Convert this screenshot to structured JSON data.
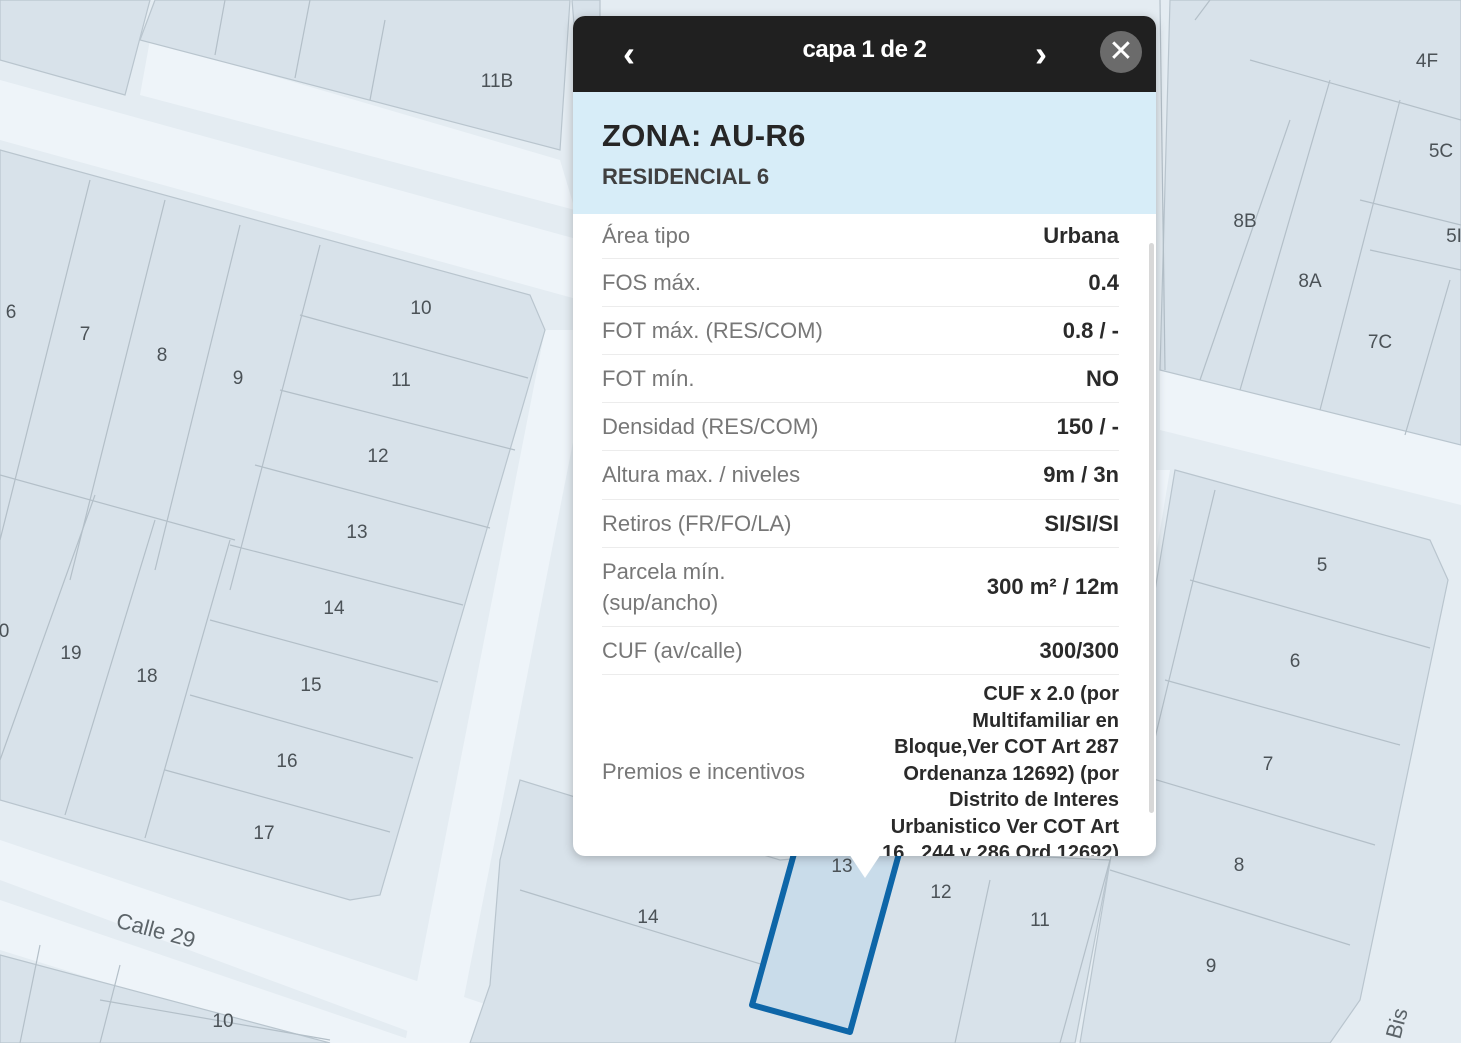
{
  "map": {
    "street_name": "Calle 29",
    "street_name_small": "Bis",
    "highlight_color": "#0e66a8",
    "lot_labels": [
      "11B",
      "6",
      "7",
      "8",
      "9",
      "10",
      "11",
      "12",
      "13",
      "14",
      "15",
      "16",
      "17",
      "18",
      "19",
      "0",
      "4F",
      "5C",
      "8B",
      "5I",
      "8A",
      "7C",
      "5",
      "6",
      "7",
      "8",
      "9",
      "10",
      "11",
      "12",
      "14",
      "13"
    ]
  },
  "popup": {
    "header": {
      "title": "capa 1 de 2",
      "prev_label": "‹",
      "next_label": "›",
      "close_label": "✕"
    },
    "zone_title": "ZONA: AU-R6",
    "zone_subtitle": "RESIDENCIAL 6",
    "attributes": [
      {
        "key": "Área tipo",
        "value": "Urbana"
      },
      {
        "key": "FOS máx.",
        "value": "0.4"
      },
      {
        "key": "FOT máx. (RES/COM)",
        "value": "0.8 / -"
      },
      {
        "key": "FOT mín.",
        "value": "NO"
      },
      {
        "key": "Densidad (RES/COM)",
        "value": "150 / -"
      },
      {
        "key": "Altura max. / niveles",
        "value": "9m / 3n"
      },
      {
        "key": "Retiros (FR/FO/LA)",
        "value": "SI/SI/SI"
      },
      {
        "key": "Parcela mín. (sup/ancho)",
        "value": "300 m² / 12m"
      },
      {
        "key": "CUF (av/calle)",
        "value": "300/300"
      },
      {
        "key": "Premios e incentivos",
        "value": "CUF x 2.0 (por Multifamiliar en Bloque,Ver COT Art 287 Ordenanza 12692) (por Distrito de Interes Urbanistico Ver COT Art 16 , 244 y 286 Ord 12692)"
      }
    ]
  },
  "colors": {
    "header_bg": "#202020",
    "zone_band_bg": "#d7edf8",
    "map_bg": "#e6eef4",
    "block_fill": "#d8e2ea",
    "street_fill": "#edf3f8"
  }
}
